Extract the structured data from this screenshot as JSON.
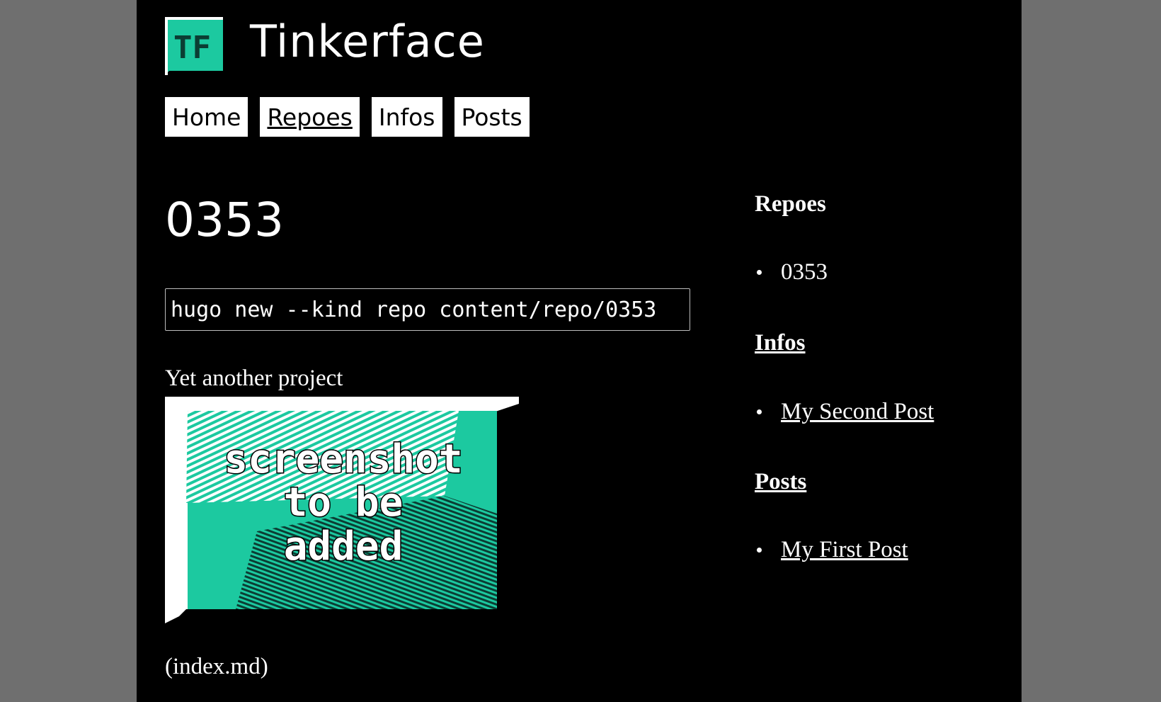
{
  "site": {
    "title": "Tinkerface",
    "logo_text": "TF",
    "accent_color": "#1cc9a0"
  },
  "nav": {
    "items": [
      {
        "label": "Home",
        "active": false
      },
      {
        "label": "Repoes",
        "active": true
      },
      {
        "label": "Infos",
        "active": false
      },
      {
        "label": "Posts",
        "active": false
      }
    ]
  },
  "main": {
    "title": "0353",
    "code": "hugo new --kind repo content/repo/0353",
    "description": "Yet another project",
    "placeholder_image": {
      "lines": [
        "screenshot",
        "to be",
        "added"
      ]
    },
    "file_note": "(index.md)"
  },
  "sidebar": {
    "sections": [
      {
        "heading": "Repoes",
        "heading_is_link": false,
        "items": [
          "0353"
        ],
        "items_are_links": false
      },
      {
        "heading": "Infos",
        "heading_is_link": true,
        "items": [
          "My Second Post"
        ],
        "items_are_links": true
      },
      {
        "heading": "Posts",
        "heading_is_link": true,
        "items": [
          "My First Post"
        ],
        "items_are_links": true
      }
    ]
  }
}
